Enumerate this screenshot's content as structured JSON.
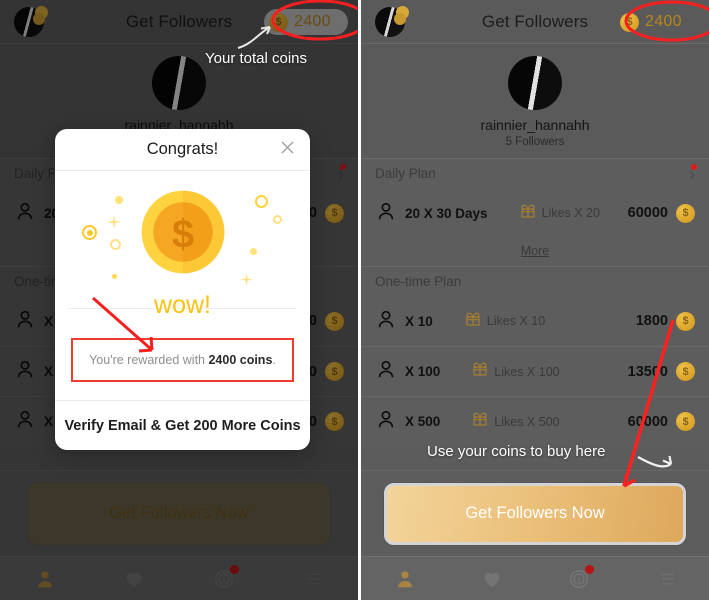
{
  "app": {
    "header_title": "Get Followers",
    "coin_count": "2400",
    "coin_symbol": "$"
  },
  "profile": {
    "username": "rainnier_hannahh",
    "followers": "5 Followers"
  },
  "sections": {
    "daily_plan_label": "Daily Plan",
    "one_time_plan_label": "One-time Plan",
    "more_label": "More"
  },
  "daily_plans": [
    {
      "qty": "20 X 30 Days",
      "likes": "Likes X 20",
      "price": "60000"
    }
  ],
  "one_time_plans": [
    {
      "qty": "X 10",
      "likes": "Likes X 10",
      "price": "1800"
    },
    {
      "qty": "X 100",
      "likes": "Likes X 100",
      "price": "13500"
    },
    {
      "qty": "X 500",
      "likes": "Likes X 500",
      "price": "60000"
    }
  ],
  "cta": {
    "label": "Get Followers Now"
  },
  "tabs": [
    {
      "name": "profile",
      "icon": "person-icon",
      "active": true
    },
    {
      "name": "likes",
      "icon": "heart-icon",
      "active": false
    },
    {
      "name": "coins",
      "icon": "coin-icon",
      "active": false
    },
    {
      "name": "list",
      "icon": "list-icon",
      "active": false
    }
  ],
  "modal": {
    "title": "Congrats!",
    "close_icon": "close-icon",
    "wow_text": "wow!",
    "reward_prefix": "You're rewarded with ",
    "reward_amount": "2400 coins",
    "reward_suffix": ".",
    "footer_label": "Verify Email & Get 200 More Coins"
  },
  "annotations": {
    "total_coins": "Your total coins",
    "use_coins": "Use your coins to buy here",
    "highlight_color": "#f42020",
    "arrow_color": "#ff2020"
  }
}
